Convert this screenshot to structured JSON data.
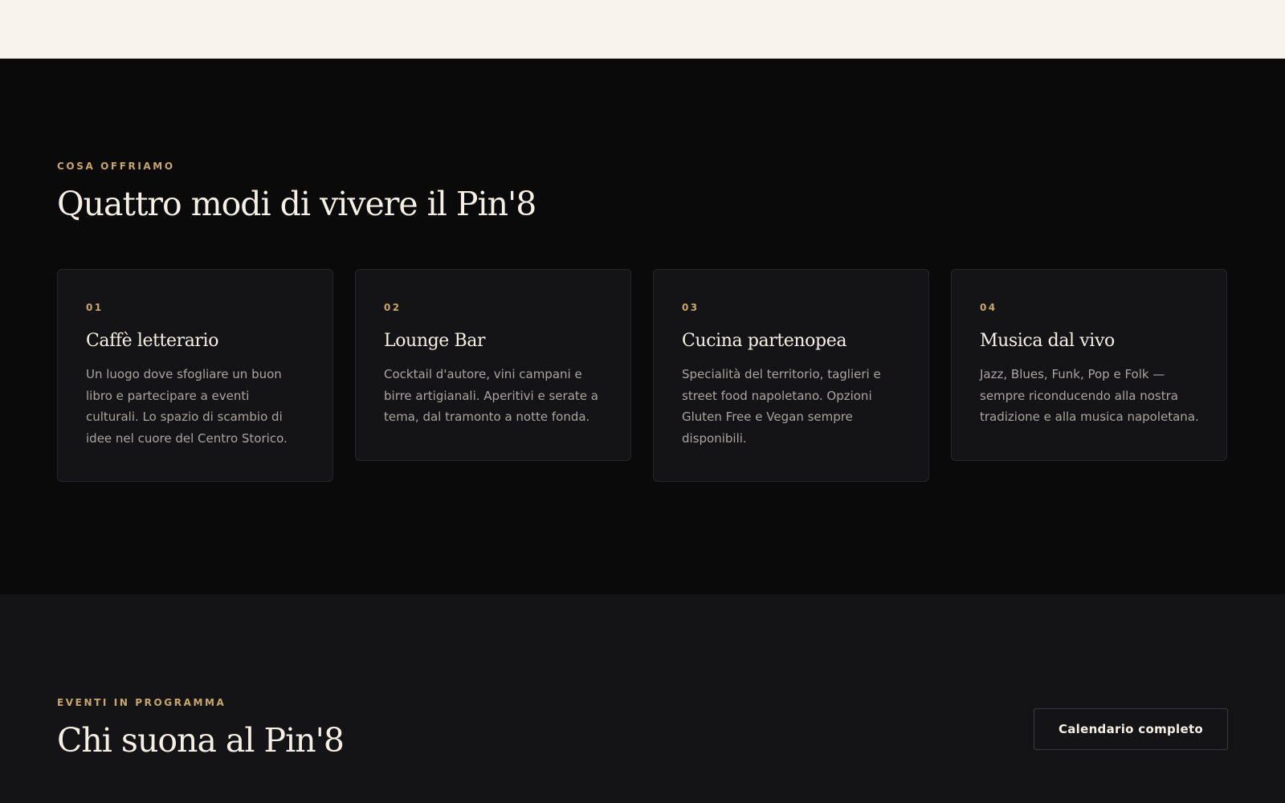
{
  "offer": {
    "eyebrow": "COSA OFFRIAMO",
    "title": "Quattro modi di vivere il Pin'8",
    "cards": [
      {
        "number": "01",
        "title": "Caffè letterario",
        "text": "Un luogo dove sfogliare un buon libro e partecipare a eventi culturali. Lo spazio di scambio di idee nel cuore del Centro Storico."
      },
      {
        "number": "02",
        "title": "Lounge Bar",
        "text": "Cocktail d'autore, vini campani e birre artigianali. Aperitivi e serate a tema, dal tramonto a notte fonda."
      },
      {
        "number": "03",
        "title": "Cucina partenopea",
        "text": "Specialità del territorio, taglieri e street food napoletano. Opzioni Gluten Free e Vegan sempre disponibili."
      },
      {
        "number": "04",
        "title": "Musica dal vivo",
        "text": "Jazz, Blues, Funk, Pop e Folk — sempre riconducendo alla nostra tradizione e alla musica napoletana."
      }
    ]
  },
  "events": {
    "eyebrow": "EVENTI IN PROGRAMMA",
    "title": "Chi suona al Pin'8",
    "calendar_button": "Calendario completo"
  },
  "colors": {
    "accent": "#c9a66b",
    "background_dark": "#0a0a0a",
    "card_background": "#141416",
    "top_band": "#f8f4ed"
  }
}
